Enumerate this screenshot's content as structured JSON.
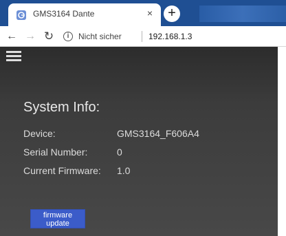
{
  "browser": {
    "tab_title": "GMS3164 Dante",
    "tab_close": "×",
    "new_tab": "+",
    "security": "Nicht sicher",
    "url": "192.168.1.3",
    "icons": {
      "back": "arrow-left-icon",
      "forward": "arrow-right-icon",
      "reload": "reload-icon",
      "info": "info-icon",
      "favicon": "favicon-icon"
    }
  },
  "page": {
    "heading": "System Info:",
    "device_label": "Device:",
    "device_value": "GMS3164_F606A4",
    "serial_label": "Serial Number:",
    "serial_value": "0",
    "firmware_label": "Current Firmware:",
    "firmware_value": "1.0",
    "firmware_button_line1": "firmware",
    "firmware_button_line2": "update"
  },
  "colors": {
    "tabstrip": "#1f4f93",
    "page_bg": "#3c3c3c",
    "button_bg": "#3b5cc9"
  }
}
